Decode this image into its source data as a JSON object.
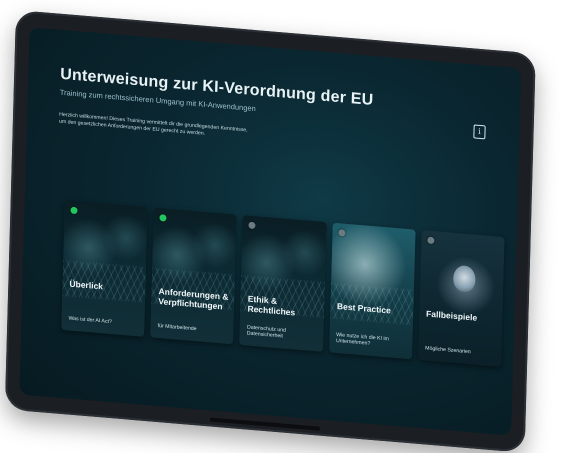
{
  "header": {
    "title": "Unterweisung zur KI-Verordnung der EU",
    "subtitle": "Training zum rechtssicheren Umgang mit KI-Anwendungen",
    "intro": "Herzlich willkommen! Dieses Training vermittelt dir die grundlegenden Kenntnisse, um den gesetzlichen Anforderungen der EU gerecht zu werden.",
    "info_icon": "i"
  },
  "modules": [
    {
      "title": "Überlick",
      "subtitle": "Was ist der AI Act?",
      "status": "completed"
    },
    {
      "title": "Anforderungen & Verpflichtungen",
      "subtitle": "für Mitarbeitende",
      "status": "completed"
    },
    {
      "title": "Ethik & Rechtliches",
      "subtitle": "Datenschutz und Datensicherheit",
      "status": "open"
    },
    {
      "title": "Best Practice",
      "subtitle": "Wie nutze ich die KI im Unternehmen?",
      "status": "open"
    },
    {
      "title": "Fallbeispiele",
      "subtitle": "Mögliche Szenarien",
      "status": "open"
    }
  ],
  "colors": {
    "accent_completed": "#22c55e",
    "accent_open": "#6b7b82",
    "screen_bg": "#0a2630"
  }
}
